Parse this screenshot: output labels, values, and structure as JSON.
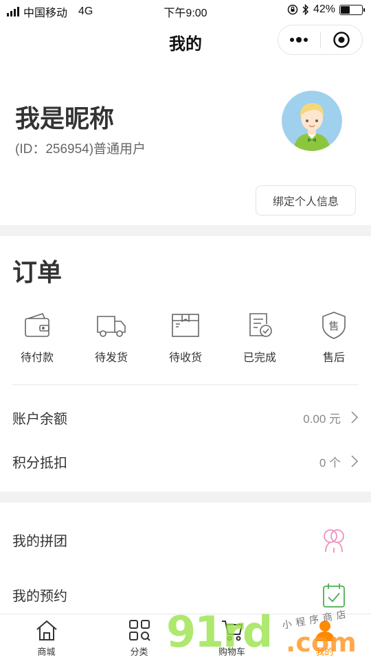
{
  "status_bar": {
    "carrier": "中国移动",
    "network": "4G",
    "time": "下午9:00",
    "battery": "42%",
    "battery_level": 0.42
  },
  "nav": {
    "title": "我的",
    "more_icon": "ellipsis-icon",
    "close_icon": "target-icon"
  },
  "profile": {
    "nickname": "我是昵称",
    "user_id": "(ID：256954)普通用户",
    "bind_button": "绑定个人信息"
  },
  "orders": {
    "title": "订单",
    "items": [
      {
        "label": "待付款",
        "icon": "wallet-icon"
      },
      {
        "label": "待发货",
        "icon": "truck-icon"
      },
      {
        "label": "待收货",
        "icon": "package-icon"
      },
      {
        "label": "已完成",
        "icon": "checklist-icon"
      },
      {
        "label": "售后",
        "icon": "shield-icon"
      }
    ]
  },
  "account": {
    "balance_label": "账户余额",
    "balance_value": "0.00 元",
    "points_label": "积分抵扣",
    "points_value": "0 个"
  },
  "more": {
    "group_buy_label": "我的拼团",
    "booking_label": "我的预约"
  },
  "tabs": [
    {
      "label": "商城",
      "icon": "home-icon"
    },
    {
      "label": "分类",
      "icon": "category-icon"
    },
    {
      "label": "购物车",
      "icon": "cart-icon"
    },
    {
      "label": "我的",
      "icon": "user-icon"
    }
  ],
  "watermark": {
    "main": "91rd",
    "suffix": ".com",
    "small": "小程序商店"
  },
  "colors": {
    "accent": "#ff8a00",
    "group_icon": "#f08fbf",
    "booking_icon": "#4caf50",
    "watermark_green": "#9be34a"
  }
}
